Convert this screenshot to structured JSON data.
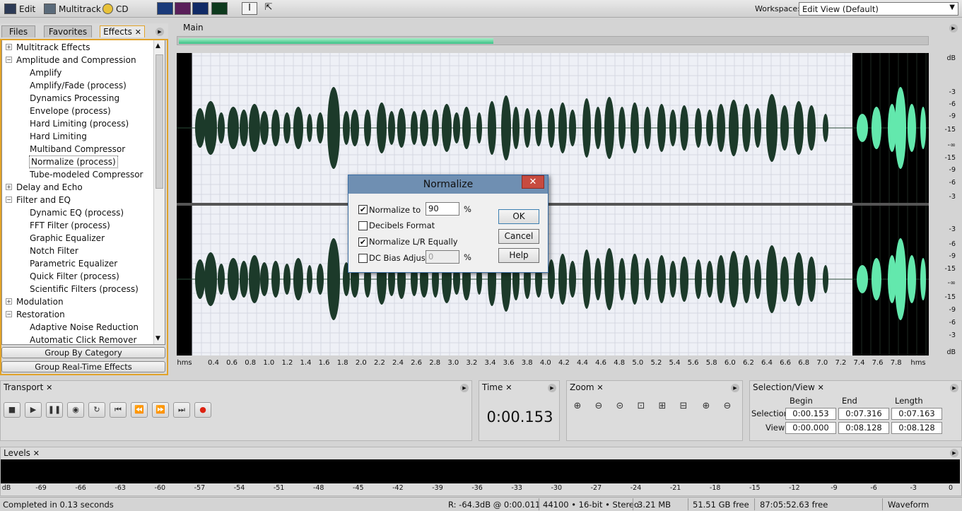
{
  "toolbar": {
    "edit_label": "Edit",
    "multitrack_label": "Multitrack",
    "cd_label": "CD",
    "workspace_label": "Workspace:",
    "workspace_value": "Edit View (Default)"
  },
  "left_panel": {
    "tabs": [
      "Files",
      "Favorites",
      "Effects"
    ],
    "tree": [
      {
        "label": "Multitrack Effects",
        "level": 0,
        "toggle": "+"
      },
      {
        "label": "Amplitude and Compression",
        "level": 0,
        "toggle": "-"
      },
      {
        "label": "Amplify",
        "level": 1
      },
      {
        "label": "Amplify/Fade (process)",
        "level": 1
      },
      {
        "label": "Dynamics Processing",
        "level": 1
      },
      {
        "label": "Envelope (process)",
        "level": 1
      },
      {
        "label": "Hard Limiting (process)",
        "level": 1
      },
      {
        "label": "Hard Limiting",
        "level": 1
      },
      {
        "label": "Multiband Compressor",
        "level": 1
      },
      {
        "label": "Normalize (process)",
        "level": 1,
        "selected": true
      },
      {
        "label": "Tube-modeled Compressor",
        "level": 1
      },
      {
        "label": "Delay and Echo",
        "level": 0,
        "toggle": "+"
      },
      {
        "label": "Filter and EQ",
        "level": 0,
        "toggle": "-"
      },
      {
        "label": "Dynamic EQ (process)",
        "level": 1
      },
      {
        "label": "FFT Filter (process)",
        "level": 1
      },
      {
        "label": "Graphic Equalizer",
        "level": 1
      },
      {
        "label": "Notch Filter",
        "level": 1
      },
      {
        "label": "Parametric Equalizer",
        "level": 1
      },
      {
        "label": "Quick Filter (process)",
        "level": 1
      },
      {
        "label": "Scientific Filters (process)",
        "level": 1
      },
      {
        "label": "Modulation",
        "level": 0,
        "toggle": "+"
      },
      {
        "label": "Restoration",
        "level": 0,
        "toggle": "-"
      },
      {
        "label": "Adaptive Noise Reduction",
        "level": 1
      },
      {
        "label": "Automatic Click Remover",
        "level": 1
      }
    ],
    "group_by_category": "Group By Category",
    "group_realtime": "Group Real-Time Effects"
  },
  "main": {
    "tab_label": "Main",
    "overview_fraction": 0.42,
    "db_labels_top": [
      "dB",
      "-3",
      "-6",
      "-9",
      "-15",
      "-∞",
      "-15",
      "-9",
      "-6",
      "-3"
    ],
    "db_labels_bottom": [
      "-3",
      "-6",
      "-9",
      "-15",
      "-∞",
      "-15",
      "-9",
      "-6",
      "-3",
      "dB"
    ],
    "time_ticks": [
      "hms",
      "0.4",
      "0.6",
      "0.8",
      "1.0",
      "1.2",
      "1.4",
      "1.6",
      "1.8",
      "2.0",
      "2.2",
      "2.4",
      "2.6",
      "2.8",
      "3.0",
      "3.2",
      "3.4",
      "3.6",
      "3.8",
      "4.0",
      "4.2",
      "4.4",
      "4.6",
      "4.8",
      "5.0",
      "5.2",
      "5.4",
      "5.6",
      "5.8",
      "6.0",
      "6.2",
      "6.4",
      "6.6",
      "6.8",
      "7.0",
      "7.2",
      "7.4",
      "7.6",
      "7.8",
      "hms"
    ],
    "waveform_color": "#1c3a2a",
    "selected_waveform_color": "#63e8ad"
  },
  "dialog": {
    "title": "Normalize",
    "normalize_to_label": "Normalize to",
    "normalize_to_checked": true,
    "normalize_value": "90",
    "percent": "%",
    "decibels_label": "Decibels Format",
    "decibels_checked": false,
    "lr_label": "Normalize L/R Equally",
    "lr_checked": true,
    "dc_label": "DC Bias Adjust",
    "dc_checked": false,
    "dc_value": "0",
    "ok": "OK",
    "cancel": "Cancel",
    "help": "Help"
  },
  "transport": {
    "title": "Transport"
  },
  "time_panel": {
    "title": "Time",
    "value": "0:00.153"
  },
  "zoom_panel": {
    "title": "Zoom"
  },
  "selection": {
    "title": "Selection/View",
    "headers": [
      "Begin",
      "End",
      "Length"
    ],
    "selection_label": "Selection",
    "view_label": "View",
    "selection_values": [
      "0:00.153",
      "0:07.316",
      "0:07.163"
    ],
    "view_values": [
      "0:00.000",
      "0:08.128",
      "0:08.128"
    ]
  },
  "levels": {
    "title": "Levels",
    "ticks": [
      "dB",
      "-69",
      "-66",
      "-63",
      "-60",
      "-57",
      "-54",
      "-51",
      "-48",
      "-45",
      "-42",
      "-39",
      "-36",
      "-33",
      "-30",
      "-27",
      "-24",
      "-21",
      "-18",
      "-15",
      "-12",
      "-9",
      "-6",
      "-3",
      "0"
    ]
  },
  "status": {
    "message": "Completed in 0.13 seconds",
    "cursor": "R: -64.3dB @  0:00.011",
    "format": "44100 • 16-bit • Stereo",
    "size": "3.21 MB",
    "disk_free": "51.51 GB free",
    "time_free": "87:05:52.63 free",
    "view_mode": "Waveform"
  }
}
